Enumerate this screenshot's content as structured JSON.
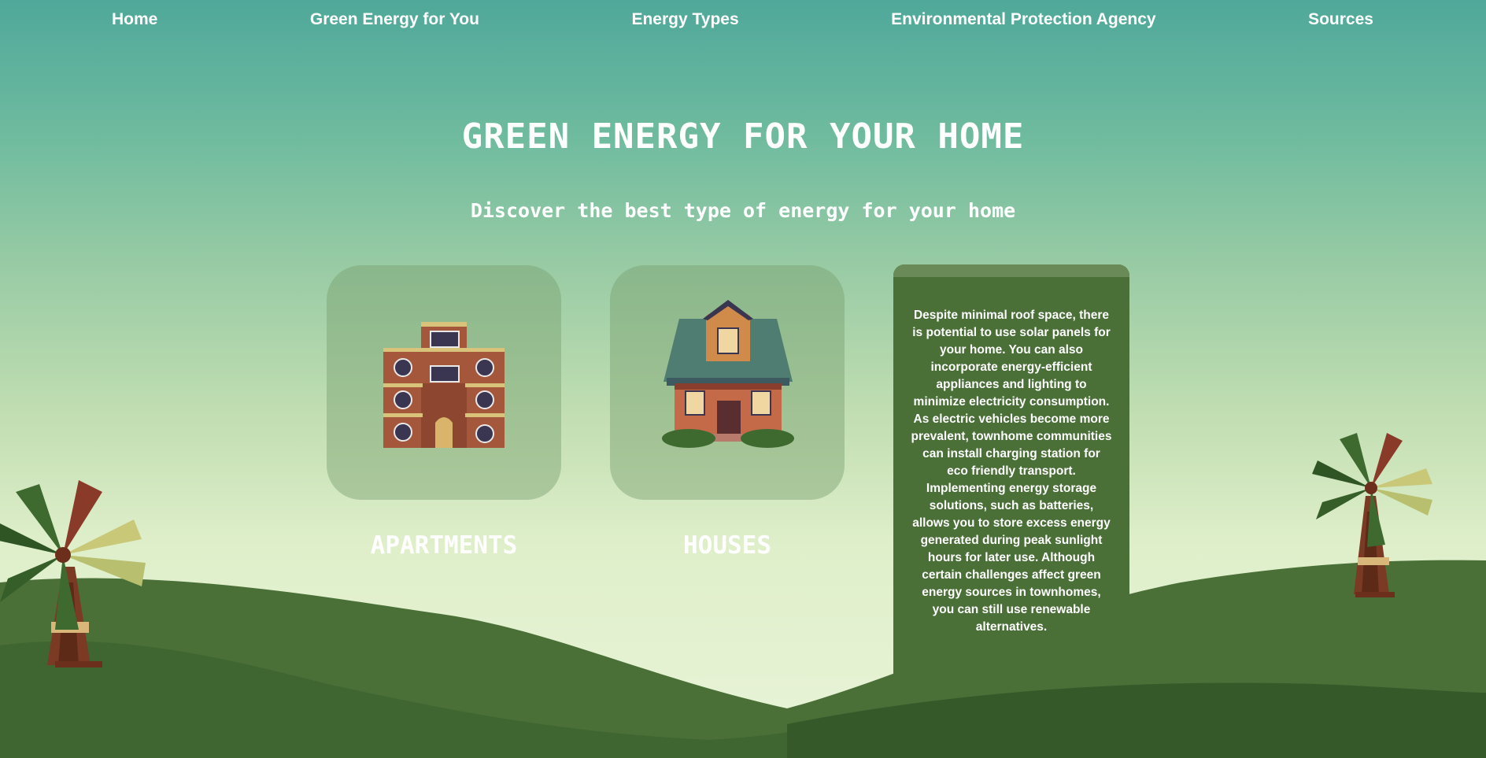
{
  "nav": {
    "items": [
      "Home",
      "Green Energy for You",
      "Energy Types",
      "Environmental Protection Agency",
      "Sources"
    ]
  },
  "hero": {
    "title": "GREEN ENERGY FOR YOUR HOME",
    "subtitle": "Discover the best type of energy for your home"
  },
  "cards": {
    "apartments": "APARTMENTS",
    "houses": "HOUSES"
  },
  "info": {
    "text": "Despite minimal roof space, there is potential to use solar panels for your home. You can also incorporate energy-efficient appliances and lighting to minimize electricity consumption. As electric vehicles become more prevalent, townhome communities can install charging station for eco friendly transport. Implementing energy storage solutions, such as batteries, allows you to store excess energy generated during peak sunlight hours for later use. Although certain challenges affect green energy sources in townhomes, you can still use renewable alternatives."
  },
  "colors": {
    "sky_top": "#4fa89a",
    "sky_bottom": "#e9f4d8",
    "hill_dark": "#3a6028",
    "hill_mid": "#4a7038",
    "info_bg": "#4a7038"
  }
}
